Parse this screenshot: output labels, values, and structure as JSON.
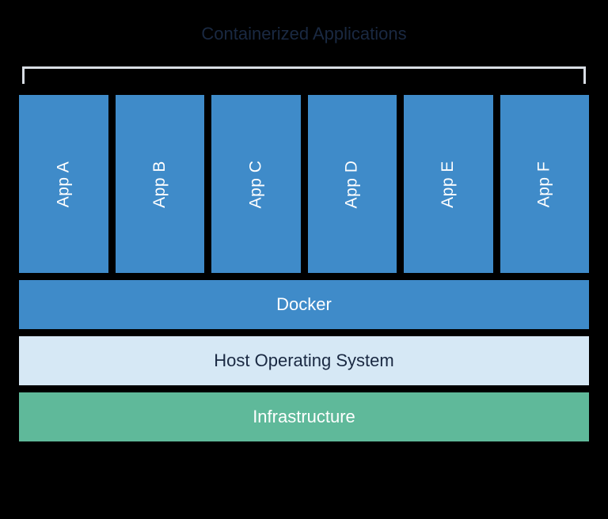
{
  "title": "Containerized Applications",
  "apps": {
    "a": "App A",
    "b": "App B",
    "c": "App C",
    "d": "App D",
    "e": "App E",
    "f": "App F"
  },
  "layers": {
    "docker": "Docker",
    "host": "Host Operating System",
    "infrastructure": "Infrastructure"
  },
  "colors": {
    "app_bg": "#3f8bc9",
    "docker_bg": "#3f8bc9",
    "host_bg": "#d6e8f5",
    "infra_bg": "#5fb99a",
    "title_color": "#1a2942",
    "bracket_color": "#d8dde4"
  }
}
